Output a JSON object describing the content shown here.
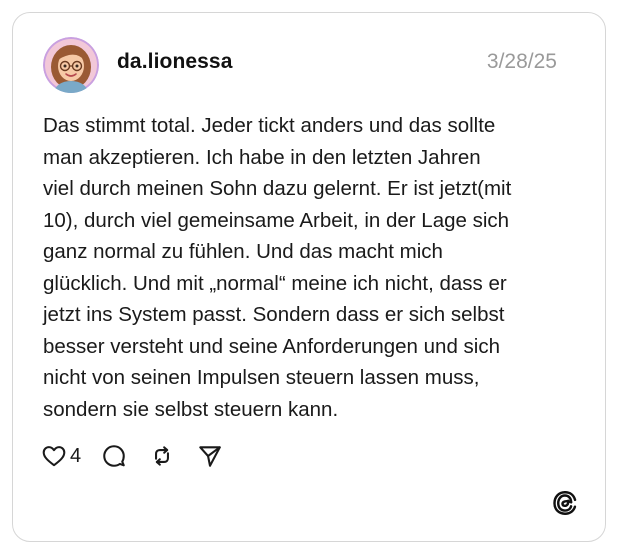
{
  "post": {
    "username": "da.lionessa",
    "timestamp": "3/28/25",
    "text_lines": [
      "Das stimmt total. Jeder tickt anders und das sollte",
      "man akzeptieren. Ich habe in den letzten Jahren",
      "viel durch meinen Sohn dazu gelernt. Er ist jetzt(mit",
      "10), durch viel gemeinsame Arbeit, in der Lage sich",
      "ganz normal zu fühlen. Und das macht mich",
      "glücklich. Und mit „normal“ meine ich nicht, dass er",
      "jetzt ins System passt. Sondern dass er sich selbst",
      "besser versteht und seine Anforderungen und sich",
      "nicht von seinen Impulsen steuern lassen muss,",
      "sondern sie selbst steuern kann."
    ],
    "like_count": "4"
  },
  "icons": {
    "like": "heart-icon",
    "reply": "comment-bubble-icon",
    "repost": "repost-icon",
    "share": "send-icon",
    "brand": "threads-logo-icon"
  },
  "colors": {
    "text": "#1a1a1a",
    "muted": "#9a9a9a",
    "border": "#d6d6d6"
  }
}
